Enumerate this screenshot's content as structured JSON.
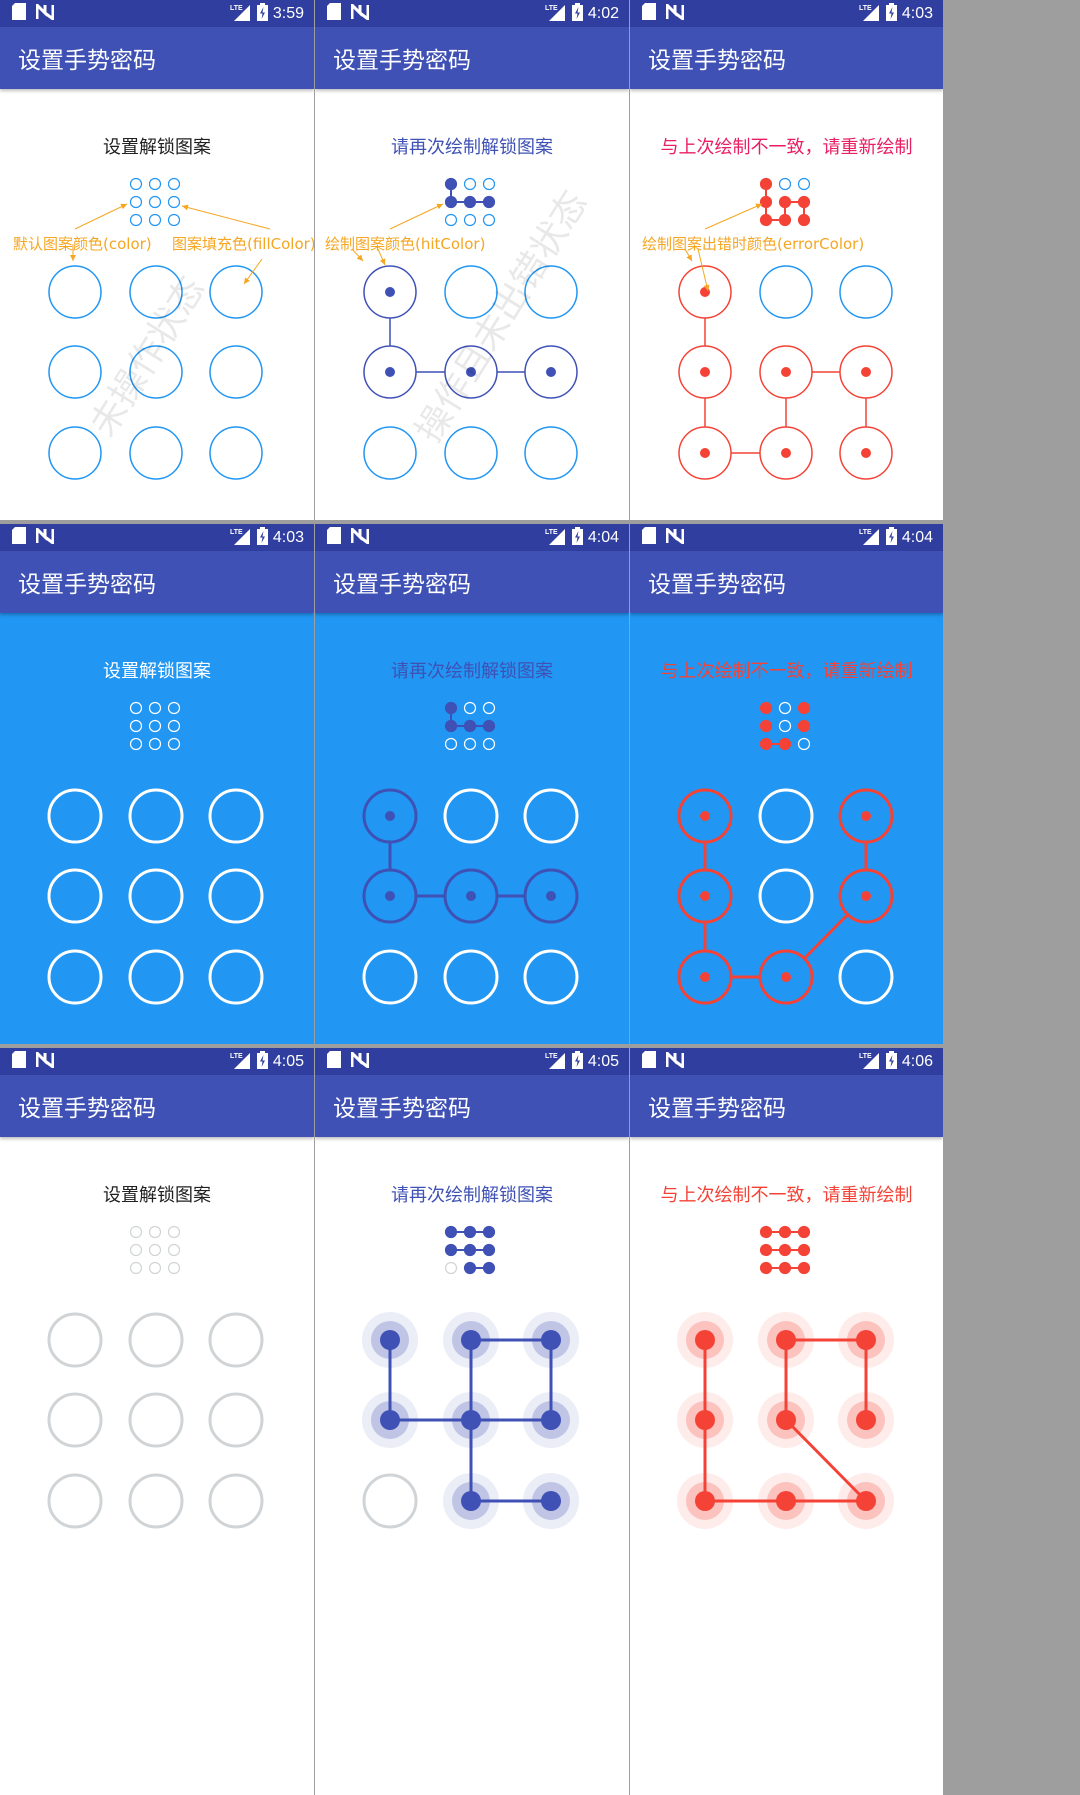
{
  "colors": {
    "status_bar": "#303f9f",
    "app_bar": "#3f51b5",
    "white": "#ffffff",
    "blue_background": "#2196f3",
    "default_color": "#2196f3",
    "hit_color": "#3f51b5",
    "error_color": "#f44336",
    "error_hint_color": "#e91e63",
    "grey_color": "#d0d4d6",
    "annotation_color": "#f5a623"
  },
  "app_title": "设置手势密码",
  "annotations": {
    "default_color": "默认图案颜色(color)",
    "fill_color": "图案填充色(fillColor)",
    "hit_color": "绘制图案颜色(hitColor)",
    "error_color": "绘制图案出错时颜色(errorColor)"
  },
  "watermarks": {
    "idle": "未操作状态",
    "hit_or_error": "操作且未出错状态"
  },
  "panels": [
    {
      "time": "3:59",
      "hint": "设置解锁图案",
      "theme": "white",
      "state": "idle",
      "path": [],
      "thumb": []
    },
    {
      "time": "4:02",
      "hint": "请再次绘制解锁图案",
      "theme": "white",
      "state": "hit",
      "path": [
        0,
        3,
        4,
        5
      ],
      "thumb": [
        0,
        3,
        4,
        5
      ]
    },
    {
      "time": "4:03",
      "hint": "与上次绘制不一致，请重新绘制",
      "theme": "white",
      "state": "error",
      "path": [
        0,
        3,
        6,
        7,
        4,
        5,
        8
      ],
      "thumb": [
        0,
        3,
        6,
        7,
        4,
        5,
        8
      ]
    },
    {
      "time": "4:03",
      "hint": "设置解锁图案",
      "theme": "blue",
      "state": "idle",
      "path": [],
      "thumb": []
    },
    {
      "time": "4:04",
      "hint": "请再次绘制解锁图案",
      "theme": "blue",
      "state": "hit",
      "path": [
        0,
        3,
        4,
        5
      ],
      "thumb": [
        0,
        3,
        4,
        5
      ]
    },
    {
      "time": "4:04",
      "hint": "与上次绘制不一致，请重新绘制",
      "theme": "blue",
      "state": "error",
      "path": [
        0,
        3,
        6,
        7,
        5,
        2
      ],
      "thumb": [
        0,
        2,
        3,
        5,
        6,
        7
      ]
    },
    {
      "time": "4:05",
      "hint": "设置解锁图案",
      "theme": "solid",
      "state": "idle",
      "path": [],
      "thumb": []
    },
    {
      "time": "4:05",
      "hint": "请再次绘制解锁图案",
      "theme": "solid",
      "state": "hit",
      "path": [
        0,
        3,
        4,
        1,
        2,
        5,
        4,
        7,
        8
      ],
      "thumb": [
        0,
        1,
        2,
        3,
        4,
        5,
        7,
        8
      ]
    },
    {
      "time": "4:06",
      "hint": "与上次绘制不一致，请重新绘制",
      "theme": "solid",
      "state": "error",
      "path": [
        0,
        3,
        6,
        7,
        8,
        4,
        1,
        2,
        5
      ],
      "thumb": [
        0,
        1,
        2,
        3,
        4,
        5,
        6,
        7,
        8
      ]
    }
  ]
}
